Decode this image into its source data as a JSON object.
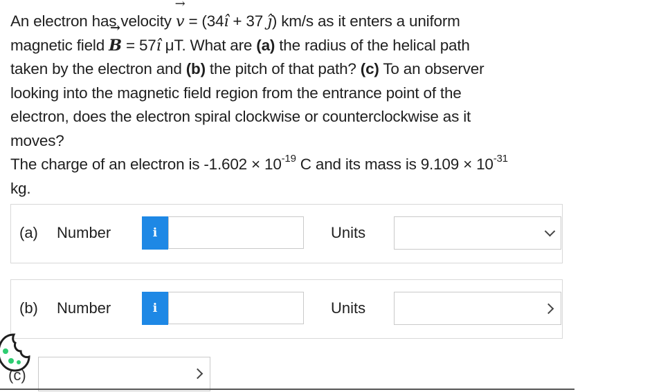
{
  "question": {
    "l1_a": "An electron has velocity ",
    "l1_v": "v",
    "l1_b": " = (34",
    "l1_i": "î",
    "l1_c": " + 37 ",
    "l1_j": "ĵ",
    "l1_d": ") km/s as it enters a uniform",
    "l2_a": "magnetic field ",
    "l2_B": "B",
    "l2_b": " = 57",
    "l2_i": "î",
    "l2_c": " μT. What are ",
    "l2_pa": "(a)",
    "l2_d": " the radius of the helical path",
    "l3_a": "taken by the electron and ",
    "l3_pb": "(b)",
    "l3_b": " the pitch of that path? ",
    "l3_pc": "(c)",
    "l3_c": " To an observer",
    "l4": "looking into the magnetic field region from the entrance point of the",
    "l5": "electron, does the electron spiral clockwise or counterclockwise as it",
    "l6": "moves?",
    "c_a": "The charge of an electron is -1.602 × 10",
    "c_exp1": "-19",
    "c_b": " C and its mass is 9.109 × 10",
    "c_exp2": "-31",
    "c_c": "kg."
  },
  "part_a": {
    "part": "(a)",
    "label": "Number",
    "info": "i",
    "units": "Units",
    "value": "",
    "unit_value": ""
  },
  "part_b": {
    "part": "(b)",
    "label": "Number",
    "info": "i",
    "units": "Units",
    "value": "",
    "unit_value": ""
  },
  "part_c": {
    "part": "(c)",
    "value": ""
  },
  "colors": {
    "info_blue": "#1e88e5",
    "border": "#d8d8d8"
  }
}
